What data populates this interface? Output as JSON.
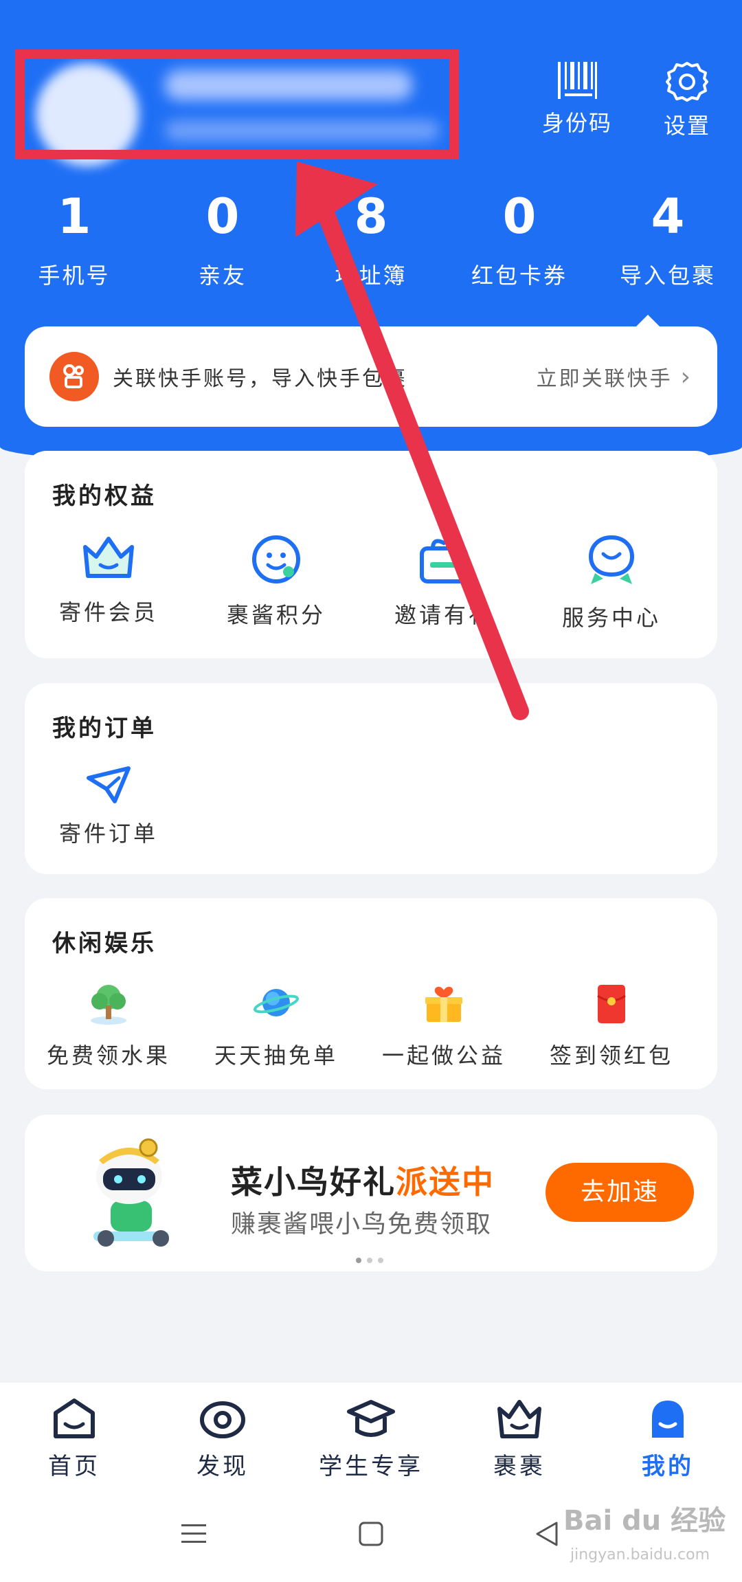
{
  "header": {
    "colors": {
      "primary": "#1f6ff5",
      "highlight": "#e8334a",
      "accent": "#ff6a00"
    },
    "actions": [
      {
        "label": "身份码",
        "icon": "barcode-icon"
      },
      {
        "label": "设置",
        "icon": "gear-icon"
      }
    ]
  },
  "stats": [
    {
      "value": "1",
      "label": "手机号"
    },
    {
      "value": "0",
      "label": "亲友"
    },
    {
      "value": "8",
      "label": "地址簿"
    },
    {
      "value": "0",
      "label": "红包卡券"
    },
    {
      "value": "4",
      "label": "导入包裹"
    }
  ],
  "link_card": {
    "text": "关联快手账号，导入快手包裹",
    "action": "立即关联快手",
    "icon": "kuaishou-icon"
  },
  "rights": {
    "title": "我的权益",
    "items": [
      {
        "label": "寄件会员",
        "icon": "crown-icon"
      },
      {
        "label": "裹酱积分",
        "icon": "smiley-icon"
      },
      {
        "label": "邀请有礼",
        "icon": "gift-icon"
      },
      {
        "label": "服务中心",
        "icon": "service-icon"
      }
    ]
  },
  "orders": {
    "title": "我的订单",
    "items": [
      {
        "label": "寄件订单",
        "icon": "send-icon"
      }
    ]
  },
  "leisure": {
    "title": "休闲娱乐",
    "items": [
      {
        "label": "免费领水果",
        "icon": "tree-icon"
      },
      {
        "label": "天天抽免单",
        "icon": "planet-icon"
      },
      {
        "label": "一起做公益",
        "icon": "charity-box-icon"
      },
      {
        "label": "签到领红包",
        "icon": "red-envelope-icon"
      }
    ]
  },
  "banner": {
    "title_main": "菜小鸟好礼",
    "title_highlight": "派送中",
    "subtitle": "赚裹酱喂小鸟免费领取",
    "button": "去加速"
  },
  "tabs": [
    {
      "label": "首页",
      "icon": "home-icon"
    },
    {
      "label": "发现",
      "icon": "eye-icon"
    },
    {
      "label": "学生专享",
      "icon": "graduation-cap-icon"
    },
    {
      "label": "裹裹",
      "icon": "crown-icon"
    },
    {
      "label": "我的",
      "icon": "user-icon",
      "active": true
    }
  ],
  "watermark": {
    "logo": "Bai du 经验",
    "url": "jingyan.baidu.com"
  }
}
